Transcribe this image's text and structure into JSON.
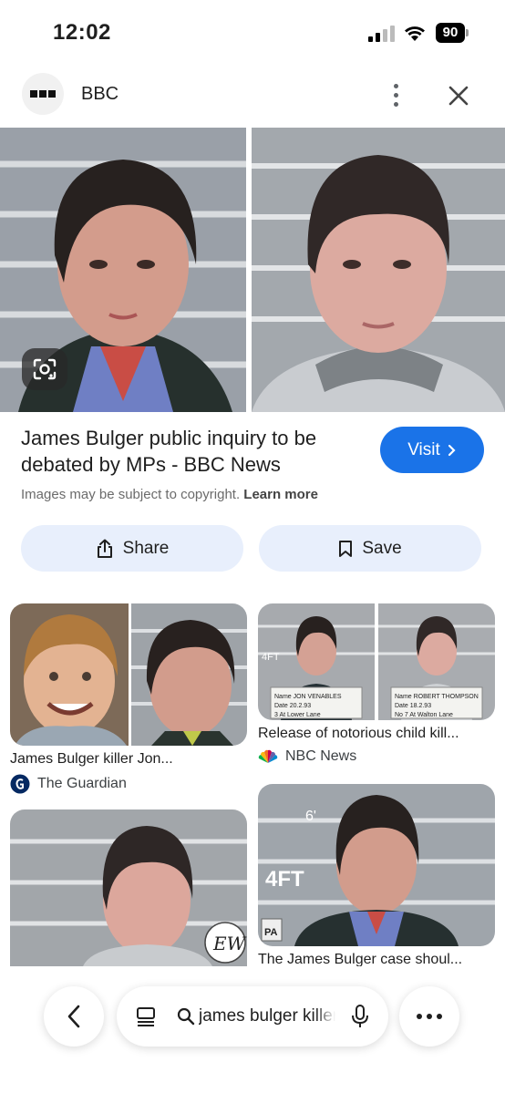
{
  "status_bar": {
    "time": "12:02",
    "battery": "90"
  },
  "header": {
    "site_name": "BBC"
  },
  "result": {
    "title": "James Bulger public inquiry to be debated by MPs - BBC News",
    "visit_label": "Visit",
    "copyright_text": "Images may be subject to copyright.",
    "learn_more": "Learn more",
    "share_label": "Share",
    "save_label": "Save"
  },
  "related": [
    {
      "caption": "James Bulger killer Jon...",
      "source": "The Guardian"
    },
    {
      "caption": "Release of notorious child kill...",
      "source": "NBC News"
    },
    {
      "caption": "The James Bulger case shoul...",
      "source": ""
    }
  ],
  "image_text": {
    "card2_board_left": "Name JON VENABLES Date 20.2.93 3 At Lower Lane",
    "card2_board_right": "Name ROBERT THOMPSON Date 18.2.93 No 7 At Walton Lane",
    "card2_height": "4FT",
    "card3_logo": "EW",
    "card4_height_6": "6'",
    "card4_height_4": "4FT",
    "card4_pa": "PA"
  },
  "bottom_bar": {
    "search_query": "james bulger killers"
  },
  "colors": {
    "accent": "#1a73e8",
    "pill_bg": "#e8effc"
  }
}
